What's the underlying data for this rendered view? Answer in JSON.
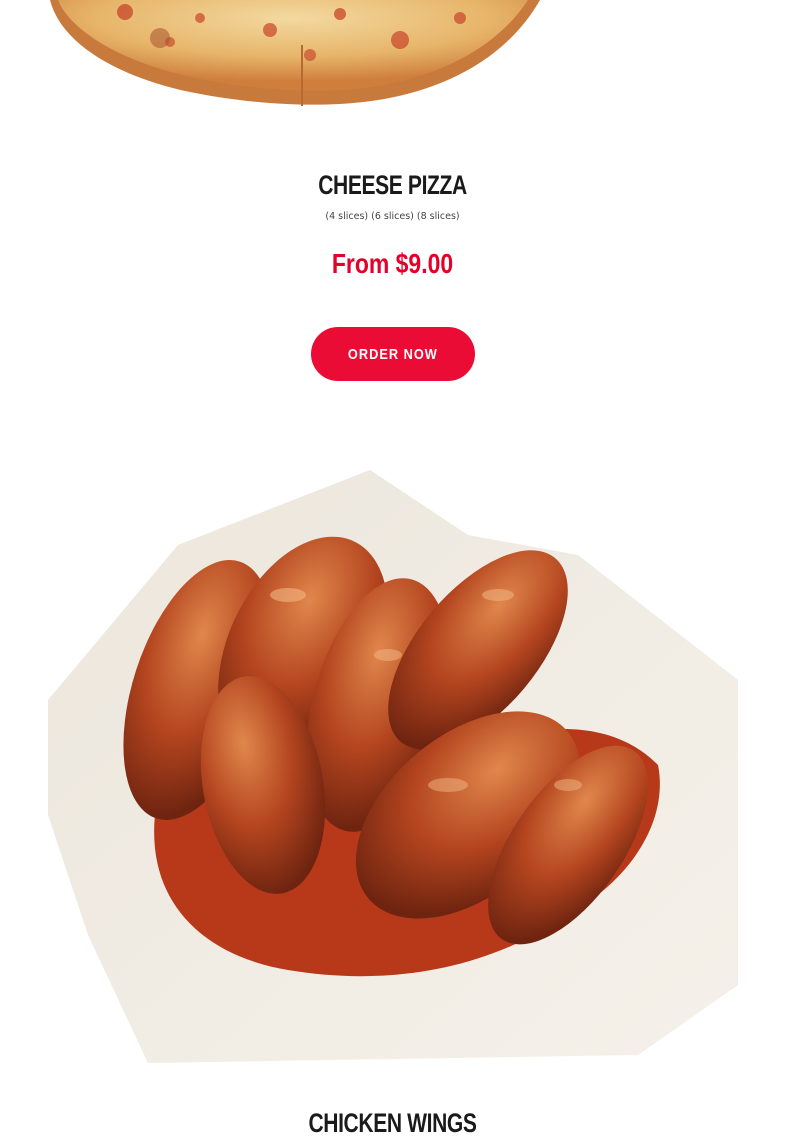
{
  "products": [
    {
      "title": "CHEESE PIZZA",
      "description": "(4 slices) (6 slices) (8 slices)",
      "price": "From $9.00",
      "order_label": "ORDER NOW"
    },
    {
      "title": "CHICKEN WINGS"
    }
  ],
  "colors": {
    "accent": "#ea0c35",
    "price": "#e4002b",
    "title": "#1a1a1a"
  }
}
